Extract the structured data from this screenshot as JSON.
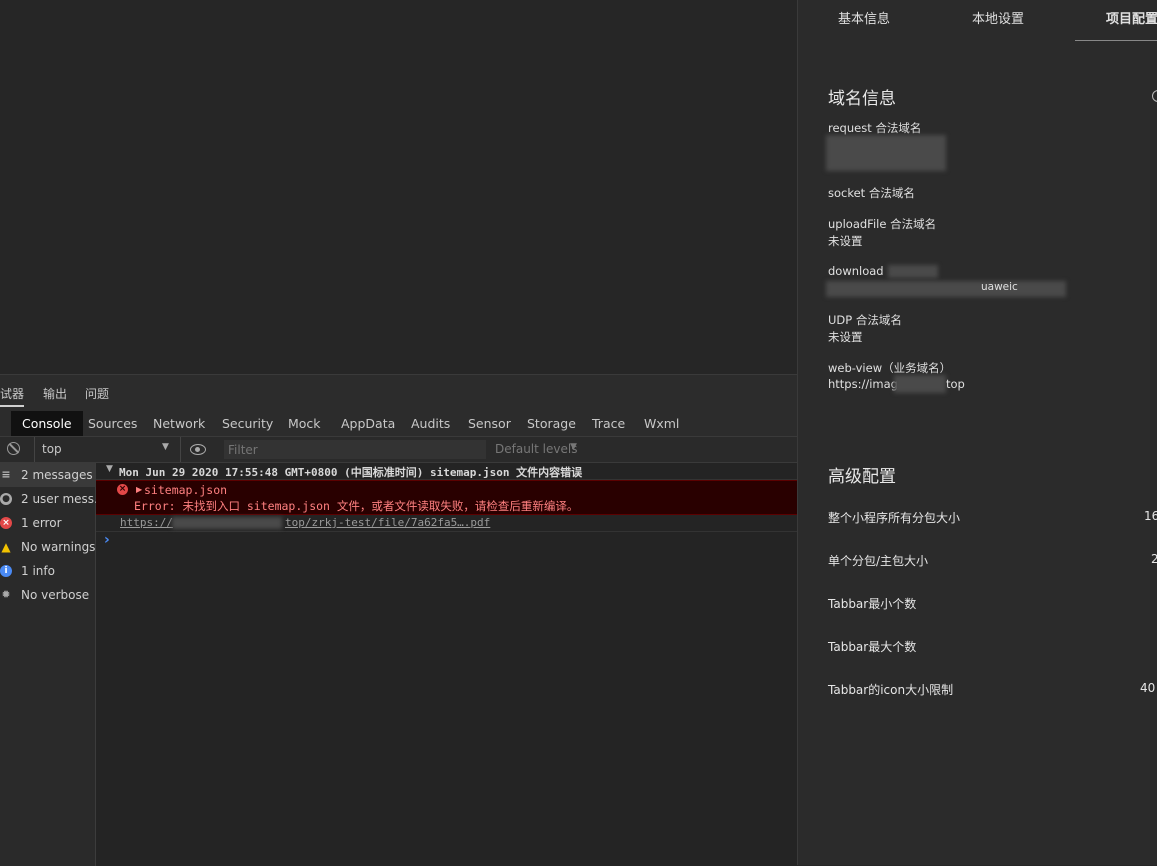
{
  "devtools": {
    "top_tabs": [
      "试器",
      "输出",
      "问题"
    ],
    "panel_tabs": [
      "Console",
      "Sources",
      "Network",
      "Security",
      "Mock",
      "AppData",
      "Audits",
      "Sensor",
      "Storage",
      "Trace",
      "Wxml"
    ],
    "active_panel": "Console",
    "toolbar": {
      "context": "top",
      "filter_placeholder": "Filter",
      "levels": "Default levels"
    },
    "sidebar": [
      {
        "icon": "list-icon",
        "label": "2 messages"
      },
      {
        "icon": "user-icon",
        "label": "2 user mess…"
      },
      {
        "icon": "error-icon",
        "label": "1 error"
      },
      {
        "icon": "warning-icon",
        "label": "No warnings"
      },
      {
        "icon": "info-icon",
        "label": "1 info"
      },
      {
        "icon": "verbose-icon",
        "label": "No verbose"
      }
    ],
    "console": {
      "group_header": "Mon Jun 29 2020 17:55:48 GMT+0800 (中国标准时间)  sitemap.json 文件内容错误",
      "error_title": "sitemap.json",
      "error_detail": "Error: 未找到入口 sitemap.json 文件，或者文件读取失败，请检查后重新编译。",
      "link_prefix": "https://",
      "link_suffix": "top/zrkj-test/file/7a62fa5….pdf",
      "prompt": "›"
    }
  },
  "right_panel": {
    "tabs": [
      "基本信息",
      "本地设置",
      "项目配置"
    ],
    "active_tab": "项目配置",
    "domain_section": {
      "title": "域名信息",
      "fields": [
        {
          "label": "request 合法域名",
          "value": ""
        },
        {
          "label": "socket 合法域名",
          "value": ""
        },
        {
          "label": "uploadFile 合法域名",
          "value": "未设置"
        },
        {
          "label": "download",
          "value": "uaweic"
        },
        {
          "label": "UDP 合法域名",
          "value": "未设置"
        },
        {
          "label": "web-view（业务域名）",
          "value_prefix": "https://image",
          "value_suffix": "top"
        }
      ]
    },
    "advanced_section": {
      "title": "高级配置",
      "rows": [
        {
          "label": "整个小程序所有分包大小",
          "value": "16"
        },
        {
          "label": "单个分包/主包大小",
          "value": "2"
        },
        {
          "label": "Tabbar最小个数",
          "value": ""
        },
        {
          "label": "Tabbar最大个数",
          "value": ""
        },
        {
          "label": "Tabbar的icon大小限制",
          "value": "40"
        }
      ]
    }
  },
  "colors": {
    "error_bg": "#290000",
    "error_text": "#ff8080",
    "error_border": "#5c0000",
    "accent_blue": "#4a8af4"
  }
}
